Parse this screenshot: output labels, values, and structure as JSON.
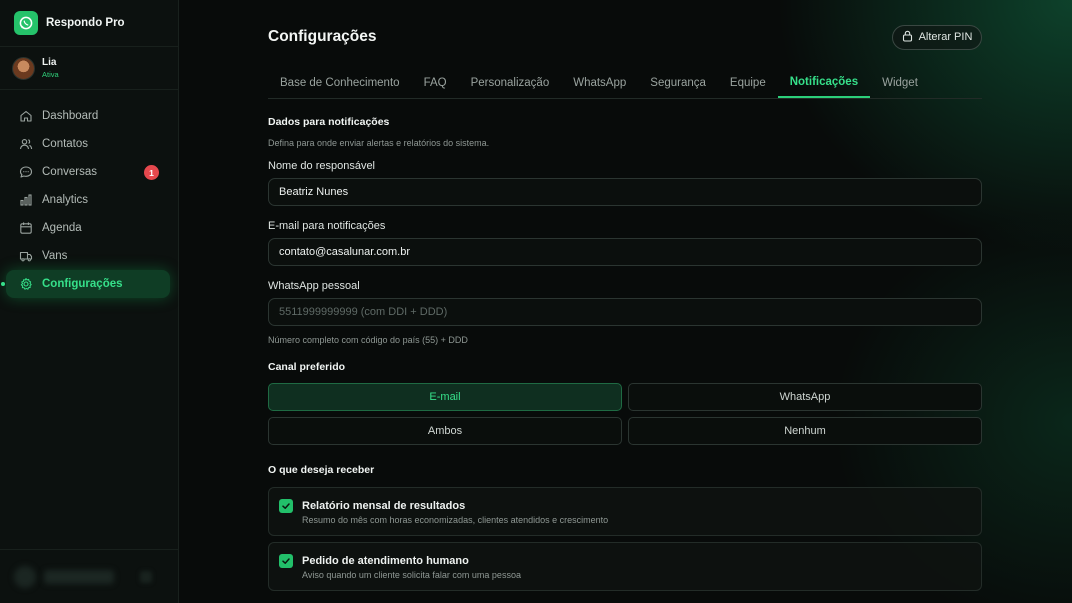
{
  "brand": {
    "name": "Respondo Pro"
  },
  "user": {
    "name": "Lia",
    "status": "Ativa"
  },
  "sidebar": {
    "items": [
      {
        "label": "Dashboard",
        "icon": "home-icon"
      },
      {
        "label": "Contatos",
        "icon": "users-icon"
      },
      {
        "label": "Conversas",
        "icon": "chat-icon",
        "badge": "1"
      },
      {
        "label": "Analytics",
        "icon": "bar-chart-icon"
      },
      {
        "label": "Agenda",
        "icon": "calendar-icon"
      },
      {
        "label": "Vans",
        "icon": "van-icon"
      },
      {
        "label": "Configurações",
        "icon": "gear-icon",
        "active": true
      }
    ]
  },
  "header": {
    "title": "Configurações",
    "pin_button": "Alterar PIN"
  },
  "tabs": [
    {
      "label": "Base de Conhecimento"
    },
    {
      "label": "FAQ"
    },
    {
      "label": "Personalização"
    },
    {
      "label": "WhatsApp"
    },
    {
      "label": "Segurança"
    },
    {
      "label": "Equipe"
    },
    {
      "label": "Notificações",
      "active": true
    },
    {
      "label": "Widget"
    }
  ],
  "notifications": {
    "section_title": "Dados para notificações",
    "section_desc": "Defina para onde enviar alertas e relatórios do sistema.",
    "name_label": "Nome do responsável",
    "name_value": "Beatriz Nunes",
    "email_label": "E-mail para notificações",
    "email_value": "contato@casalunar.com.br",
    "whatsapp_label": "WhatsApp pessoal",
    "whatsapp_value": "",
    "whatsapp_placeholder": "5511999999999 (com DDI + DDD)",
    "whatsapp_hint": "Número completo com código do país (55) + DDD",
    "channel_label": "Canal preferido",
    "channels": [
      {
        "label": "E-mail",
        "selected": true
      },
      {
        "label": "WhatsApp",
        "selected": false
      },
      {
        "label": "Ambos",
        "selected": false
      },
      {
        "label": "Nenhum",
        "selected": false
      }
    ],
    "receive_label": "O que deseja receber",
    "options": [
      {
        "title": "Relatório mensal de resultados",
        "desc": "Resumo do mês com horas economizadas, clientes atendidos e crescimento",
        "checked": true
      },
      {
        "title": "Pedido de atendimento humano",
        "desc": "Aviso quando um cliente solicita falar com uma pessoa",
        "checked": true
      }
    ]
  },
  "colors": {
    "accent": "#36e08a",
    "accent_dark": "#0f3d25",
    "badge": "#e5484d",
    "background": "#080b0a"
  }
}
